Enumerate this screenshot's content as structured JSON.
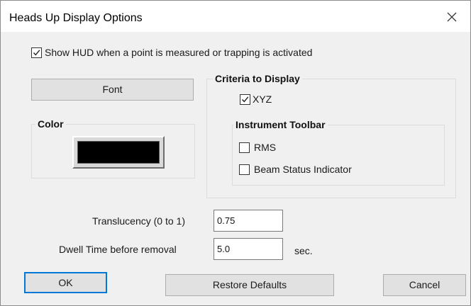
{
  "dialog": {
    "title": "Heads Up Display Options",
    "close_icon": "close-icon"
  },
  "show_hud": {
    "label": "Show HUD when a point is measured or trapping is activated",
    "checked": true
  },
  "font_button": {
    "label": "Font"
  },
  "color_group": {
    "title": "Color",
    "swatch_color": "#000000"
  },
  "criteria_group": {
    "title": "Criteria to Display",
    "xyz": {
      "label": "XYZ",
      "checked": true
    }
  },
  "instrument_toolbar": {
    "title": "Instrument Toolbar",
    "rms": {
      "label": "RMS",
      "checked": false
    },
    "beam_status": {
      "label": "Beam Status Indicator",
      "checked": false
    }
  },
  "translucency": {
    "label": "Translucency (0 to 1)",
    "value": "0.75"
  },
  "dwell_time": {
    "label": "Dwell Time before removal",
    "value": "5.0",
    "unit": "sec."
  },
  "footer": {
    "ok_label": "OK",
    "restore_label": "Restore Defaults",
    "cancel_label": "Cancel"
  },
  "colors": {
    "accent": "#0078d7",
    "dialog_bg": "#f0f0f0",
    "button_bg": "#e1e1e1"
  }
}
